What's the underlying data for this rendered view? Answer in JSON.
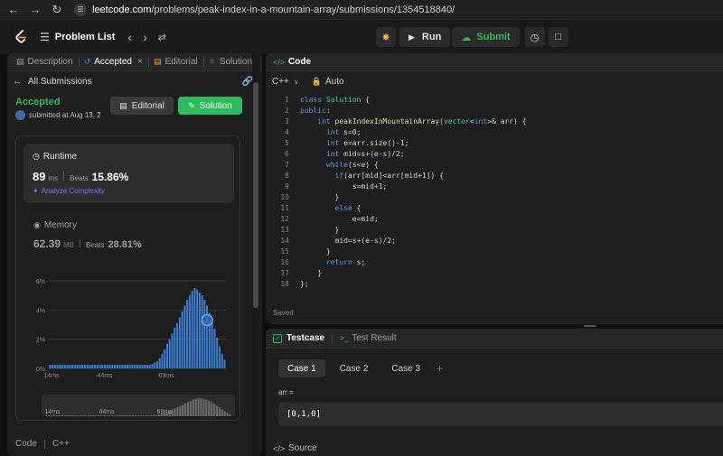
{
  "browser": {
    "back_icon": "back-arrow-icon",
    "forward_icon": "forward-arrow-icon",
    "reload_icon": "reload-icon",
    "url_host": "leetcode.com",
    "url_path": "/problems/peak-index-in-a-mountain-array/submissions/1354518840/"
  },
  "topbar": {
    "problem_list_label": "Problem List",
    "run_label": "Run",
    "submit_label": "Submit"
  },
  "left_tabs": [
    {
      "label": "Description",
      "icon": "description-icon"
    },
    {
      "label": "Accepted",
      "icon": "accepted-icon"
    },
    {
      "label": "Editorial",
      "icon": "editorial-icon"
    },
    {
      "label": "Solutions",
      "icon": "solutions-icon"
    }
  ],
  "submission": {
    "all_submissions_label": "All Submissions",
    "status": "Accepted",
    "submitted_text": "submitted at Aug 13, 2",
    "editorial_button": "Editorial",
    "solution_button": "Solution",
    "runtime": {
      "label": "Runtime",
      "value": "89",
      "unit": "ms",
      "beats_label": "Beats",
      "beats_pct": "15.86%",
      "analyze_label": "Analyze Complexity"
    },
    "memory": {
      "label": "Memory",
      "value": "62.39",
      "unit": "MB",
      "beats_label": "Beats",
      "beats_pct": "28.81%"
    },
    "code_label": "Code",
    "code_lang": "C++"
  },
  "chart_data": {
    "type": "bar",
    "ylabel": "",
    "xlabel": "",
    "yticks": [
      "6%",
      "4%",
      "2%",
      "0%"
    ],
    "ylim": [
      0,
      6
    ],
    "xticks": [
      "14ms",
      "44ms",
      "69ms"
    ],
    "mini_xticks": [
      "14ms",
      "44ms",
      "69ms"
    ],
    "values": [
      0.25,
      0.25,
      0.25,
      0.25,
      0.25,
      0.25,
      0.25,
      0.25,
      0.25,
      0.25,
      0.25,
      0.25,
      0.25,
      0.25,
      0.25,
      0.25,
      0.25,
      0.25,
      0.25,
      0.25,
      0.25,
      0.25,
      0.25,
      0.25,
      0.25,
      0.25,
      0.25,
      0.25,
      0.25,
      0.25,
      0.25,
      0.25,
      0.25,
      0.25,
      0.25,
      0.25,
      0.25,
      0.25,
      0.25,
      0.25,
      0.25,
      0.3,
      0.4,
      0.5,
      0.7,
      1.0,
      1.3,
      1.7,
      2.0,
      2.4,
      2.8,
      3.1,
      3.5,
      3.9,
      4.3,
      4.7,
      5.0,
      5.3,
      5.5,
      5.4,
      5.2,
      5.0,
      4.7,
      4.3,
      3.8,
      3.2,
      2.7,
      2.1,
      1.5,
      1.0,
      0.6
    ],
    "highlight_index": 63,
    "color": "#3d7fd6",
    "grid": true
  },
  "editor": {
    "header": "Code",
    "language": "C++",
    "mode": "Auto",
    "saved_label": "Saved",
    "lines": [
      "class Solution {",
      "public:",
      "    int peakIndexInMountainArray(vector<int>& arr) {",
      "      int s=0;",
      "      int e=arr.size()-1;",
      "      int mid=s+(e-s)/2;",
      "      while(s<e) {",
      "        if(arr[mid]<arr[mid+1]) {",
      "            s=mid+1;",
      "        }",
      "        else {",
      "            e=mid;",
      "        }",
      "        mid=s+(e-s)/2;",
      "      }",
      "      return s;",
      "    }",
      "};"
    ]
  },
  "testcase": {
    "tab_label": "Testcase",
    "result_label": "Test Result",
    "cases": [
      "Case 1",
      "Case 2",
      "Case 3"
    ],
    "add_symbol": "+",
    "arr_label": "arr =",
    "arr_value": "[0,1,0]",
    "source_label": "Source"
  }
}
